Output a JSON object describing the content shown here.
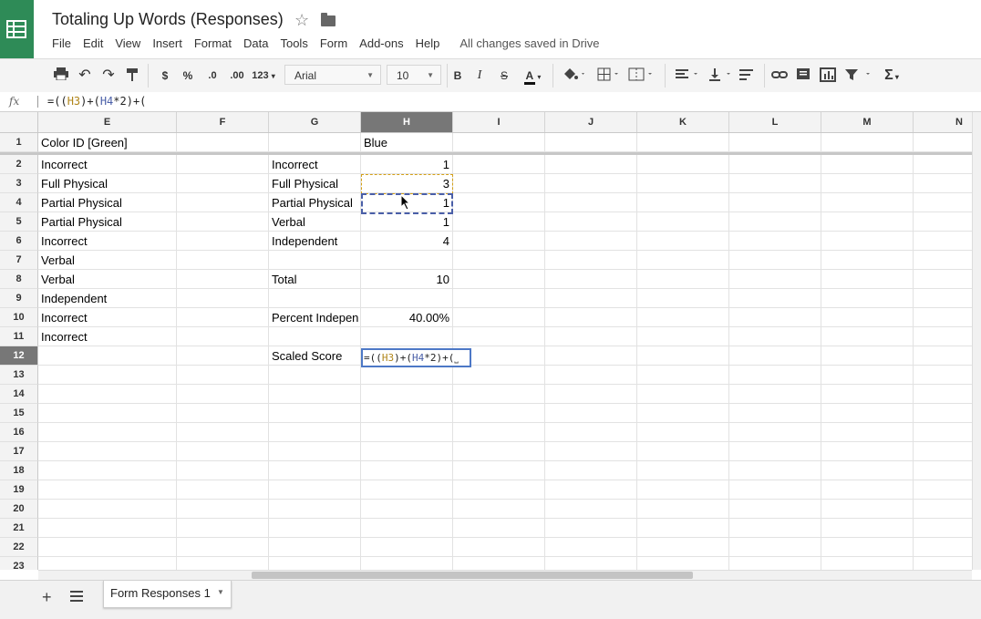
{
  "app": {
    "title": "Totaling Up Words (Responses)",
    "star_icon": "star-outline-icon",
    "folder_icon": "folder-icon",
    "logo_icon": "sheets-logo-icon",
    "menus": [
      "File",
      "Edit",
      "View",
      "Insert",
      "Format",
      "Data",
      "Tools",
      "Form",
      "Add-ons",
      "Help"
    ],
    "save_status": "All changes saved in Drive"
  },
  "toolbar": {
    "currency": "$",
    "percent": "%",
    "decrease_decimals": ".0",
    "increase_decimals": ".00",
    "more_formats": "123",
    "font": "Arial",
    "font_size": "10",
    "bold": "B",
    "italic": "I",
    "strikethrough": "S",
    "text_color": "A",
    "functions": "Σ",
    "icons": [
      "print-icon",
      "undo-icon",
      "redo-icon",
      "paint-format-icon",
      "fill-color-icon",
      "borders-icon",
      "merge-cells-icon",
      "horizontal-align-icon",
      "vertical-align-icon",
      "text-wrap-icon",
      "insert-link-icon",
      "insert-comment-icon",
      "insert-chart-icon",
      "filter-icon"
    ]
  },
  "formula_bar": {
    "label": "fx",
    "parts": [
      "=((",
      "H3",
      ")+(",
      "H4",
      "*2)+("
    ]
  },
  "columns": [
    "E",
    "F",
    "G",
    "H",
    "I",
    "J",
    "K",
    "L",
    "M",
    "N"
  ],
  "selected_column": "H",
  "rows": [
    "1",
    "2",
    "3",
    "4",
    "5",
    "6",
    "7",
    "8",
    "9",
    "10",
    "11",
    "12",
    "13",
    "14",
    "15",
    "16",
    "17",
    "18",
    "19",
    "20",
    "21",
    "22",
    "23"
  ],
  "selected_row": "12",
  "cells": {
    "E": [
      "Color ID [Green]",
      "Incorrect",
      "Full Physical",
      "Partial Physical",
      "Partial Physical",
      "Incorrect",
      "Verbal",
      "Verbal",
      "Independent",
      "Incorrect",
      "Incorrect"
    ],
    "G": [
      "",
      "Incorrect",
      "Full Physical",
      "Partial Physical",
      "Verbal",
      "Independent",
      "",
      "Total",
      "",
      "Percent Indepen",
      "",
      "Scaled Score"
    ],
    "H": [
      "Blue",
      "1",
      "3",
      "1",
      "1",
      "4",
      "",
      "10",
      "",
      "40.00%",
      "",
      ""
    ]
  },
  "editing_cell": {
    "parts": [
      "=((",
      "H3",
      ")+(",
      "H4",
      "*2)+(",
      "⎵"
    ]
  },
  "sheets": {
    "add_icon": "+",
    "list_icon": "sheet-list-icon",
    "tabs": [
      "Form Responses 1"
    ]
  },
  "colors": {
    "logo_green": "#2e8b57",
    "ref_h3": "#b0851a",
    "ref_h4": "#4a5fa8",
    "edit_border": "#4d78c6"
  }
}
